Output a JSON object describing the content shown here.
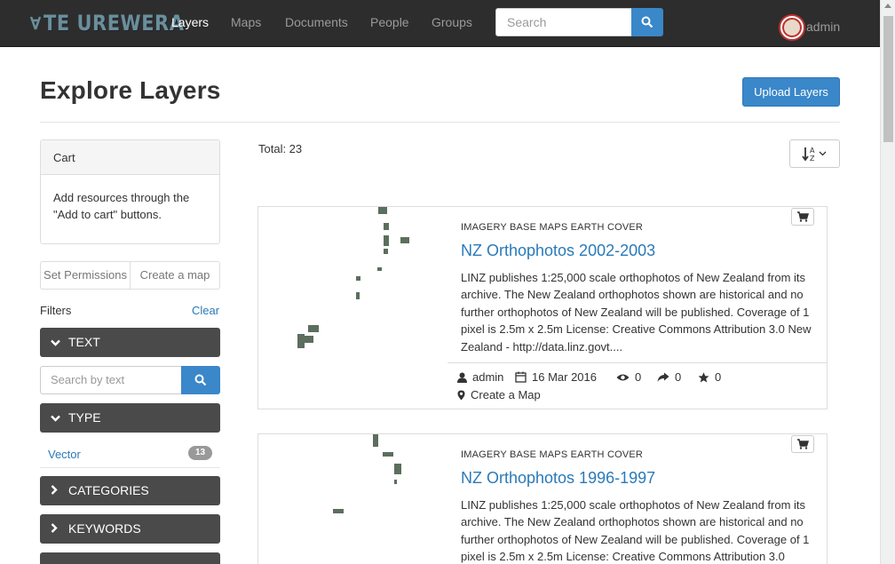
{
  "navbar": {
    "logo_text": "TE UREWERA",
    "links": [
      {
        "label": "Layers",
        "active": true
      },
      {
        "label": "Maps",
        "active": false
      },
      {
        "label": "Documents",
        "active": false
      },
      {
        "label": "People",
        "active": false
      },
      {
        "label": "Groups",
        "active": false
      }
    ],
    "search_placeholder": "Search",
    "user": "admin"
  },
  "page": {
    "title": "Explore Layers",
    "upload_label": "Upload Layers"
  },
  "sidebar": {
    "cart_title": "Cart",
    "cart_body": "Add resources through the \"Add to cart\" buttons.",
    "set_permissions": "Set Permissions",
    "create_map": "Create a map",
    "filters_label": "Filters",
    "clear_label": "Clear",
    "facets": {
      "text": "TEXT",
      "type": "TYPE",
      "categories": "CATEGORIES",
      "keywords": "KEYWORDS"
    },
    "text_search_placeholder": "Search by text",
    "type_items": [
      {
        "label": "Vector",
        "count": "13"
      }
    ]
  },
  "results": {
    "total": "Total: 23",
    "cards": [
      {
        "category": "IMAGERY BASE MAPS EARTH COVER",
        "title": "NZ Orthophotos 2002-2003",
        "description": "LINZ publishes 1:25,000 scale orthophotos of New Zealand from its archive. The New Zealand orthophotos shown are historical and no further orthophotos of New Zealand will be published. Coverage of 1 pixel is 2.5m x 2.5m License: Creative Commons Attribution 3.0 New Zealand - http://data.linz.govt....",
        "owner": "admin",
        "date": "16 Mar 2016",
        "views": "0",
        "shares": "0",
        "stars": "0",
        "create_map": "Create a Map"
      },
      {
        "category": "IMAGERY BASE MAPS EARTH COVER",
        "title": "NZ Orthophotos 1996-1997",
        "description": "LINZ publishes 1:25,000 scale orthophotos of New Zealand from its archive. The New Zealand orthophotos shown are historical and no further orthophotos of New Zealand will be published. Coverage of 1 pixel is 2.5m x 2.5m License: Creative Commons Attribution 3.0"
      }
    ]
  },
  "colors": {
    "navbar": "#2d2d2d",
    "primary": "#3a87c9",
    "link": "#2a7ab8",
    "facet": "#4a4a4a"
  }
}
